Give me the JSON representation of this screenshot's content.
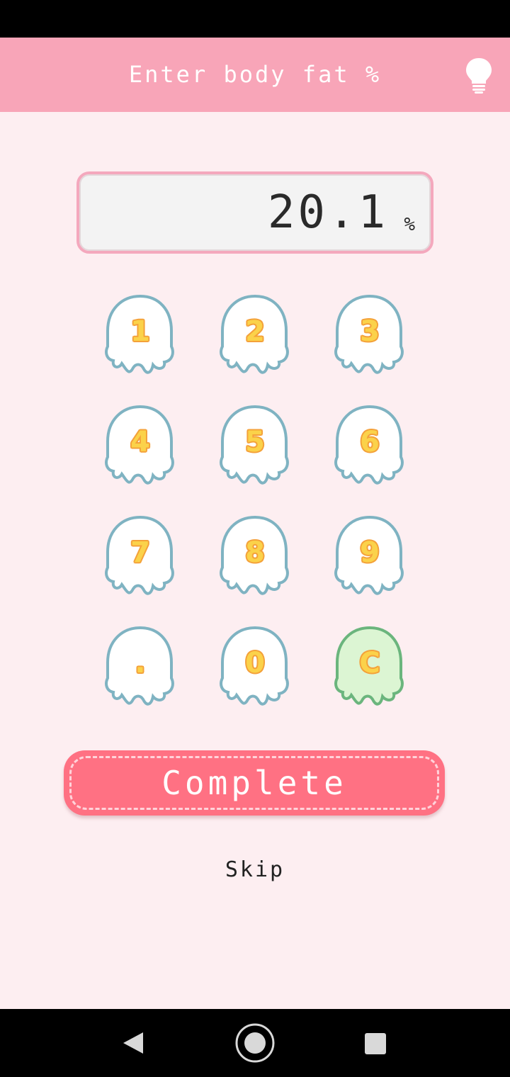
{
  "header": {
    "title": "Enter body fat %",
    "hint_icon": "lightbulb-icon"
  },
  "display": {
    "value": "20.1",
    "unit": "%"
  },
  "keypad": {
    "keys": [
      "1",
      "2",
      "3",
      "4",
      "5",
      "6",
      "7",
      "8",
      "9",
      ".",
      "0",
      "C"
    ]
  },
  "actions": {
    "complete_label": "Complete",
    "skip_label": "Skip"
  },
  "navigation": {
    "back_icon": "triangle-back-icon",
    "home_icon": "circle-home-icon",
    "recent_icon": "square-recent-icon"
  },
  "colors": {
    "header": "#f8a5b8",
    "background": "#fdeef1",
    "complete_button": "#ff7183",
    "key_outline": "#7fb3c2",
    "clear_key_fill": "#dcf5d3",
    "clear_key_outline": "#6bb57d",
    "digit_fill": "#fbd24a"
  }
}
